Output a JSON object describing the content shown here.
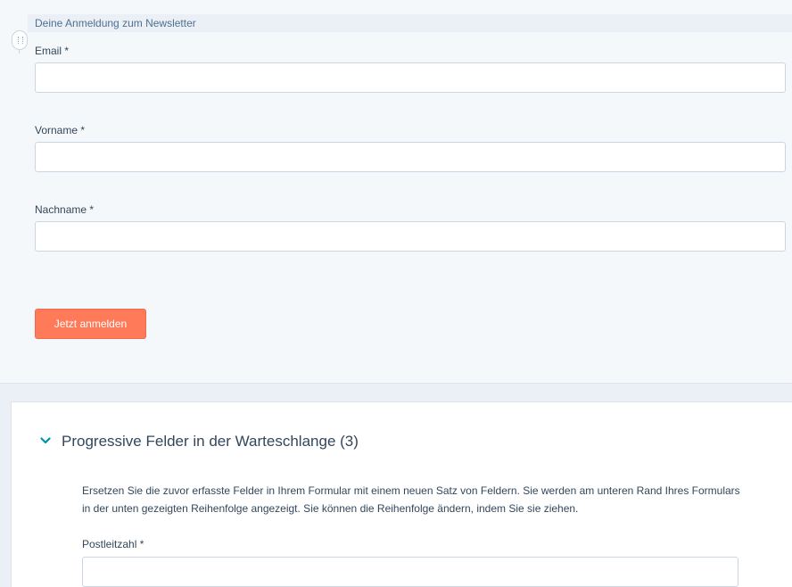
{
  "form_preview": {
    "header": "Deine Anmeldung zum Newsletter",
    "fields": [
      {
        "label": "Email *",
        "value": ""
      },
      {
        "label": "Vorname *",
        "value": ""
      },
      {
        "label": "Nachname *",
        "value": ""
      }
    ],
    "submit_label": "Jetzt anmelden"
  },
  "progressive_panel": {
    "title": "Progressive Felder in der Warteschlange (3)",
    "description_line1": "Ersetzen Sie die zuvor erfasste Felder in Ihrem Formular mit einem neuen Satz von Feldern. Sie werden am unteren Rand Ihres Formulars",
    "description_line2": "in der unten gezeigten Reihenfolge angezeigt. Sie können die Reihenfolge ändern, indem Sie sie ziehen.",
    "field": {
      "label": "Postleitzahl *",
      "value": ""
    }
  },
  "colors": {
    "accent": "#ff7a59",
    "chevron": "#0091ae",
    "text": "#33475b"
  },
  "icons": {
    "drag_handle": "drag-handle-icon",
    "chevron": "chevron-down-icon"
  }
}
